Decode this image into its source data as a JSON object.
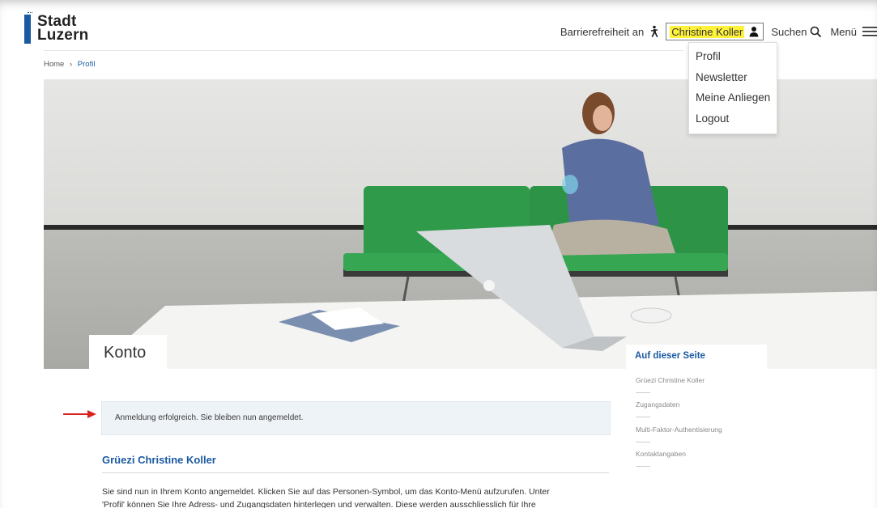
{
  "header": {
    "logo_line1": "Stadt",
    "logo_line2": "Luzern",
    "accessibility_label": "Barrierefreiheit an",
    "user_name": "Christine Koller",
    "search_label": "Suchen",
    "menu_label": "Menü"
  },
  "user_menu": {
    "items": [
      "Profil",
      "Newsletter",
      "Meine Anliegen",
      "Logout"
    ]
  },
  "breadcrumb": {
    "home": "Home",
    "separator": "›",
    "current": "Profil"
  },
  "hero": {
    "title": "Konto"
  },
  "on_this_page": {
    "heading": "Auf dieser Seite",
    "items": [
      "Grüezi Christine Koller",
      "Zugangsdaten",
      "Multi-Faktor-Authentisierung",
      "Kontaktangaben"
    ]
  },
  "message": {
    "text": "Anmeldung erfolgreich. Sie bleiben nun angemeldet."
  },
  "content": {
    "greeting": "Grüezi Christine Koller",
    "paragraph_line1": "Sie sind nun in Ihrem Konto angemeldet. Klicken Sie auf das Personen-Symbol, um das Konto-Menü aufzurufen. Unter",
    "paragraph_line2": "'Profil' können Sie Ihre Adress- und Zugangsdaten hinterlegen und verwalten. Diese werden ausschliesslich für Ihre"
  },
  "colors": {
    "brand_blue": "#1a5aa0",
    "highlight_yellow": "#fff23a",
    "arrow_red": "#d9221c",
    "message_bg": "#eef3f7"
  },
  "icons": [
    "accessibility-icon",
    "person-icon",
    "search-icon",
    "hamburger-icon",
    "red-arrow-icon"
  ]
}
